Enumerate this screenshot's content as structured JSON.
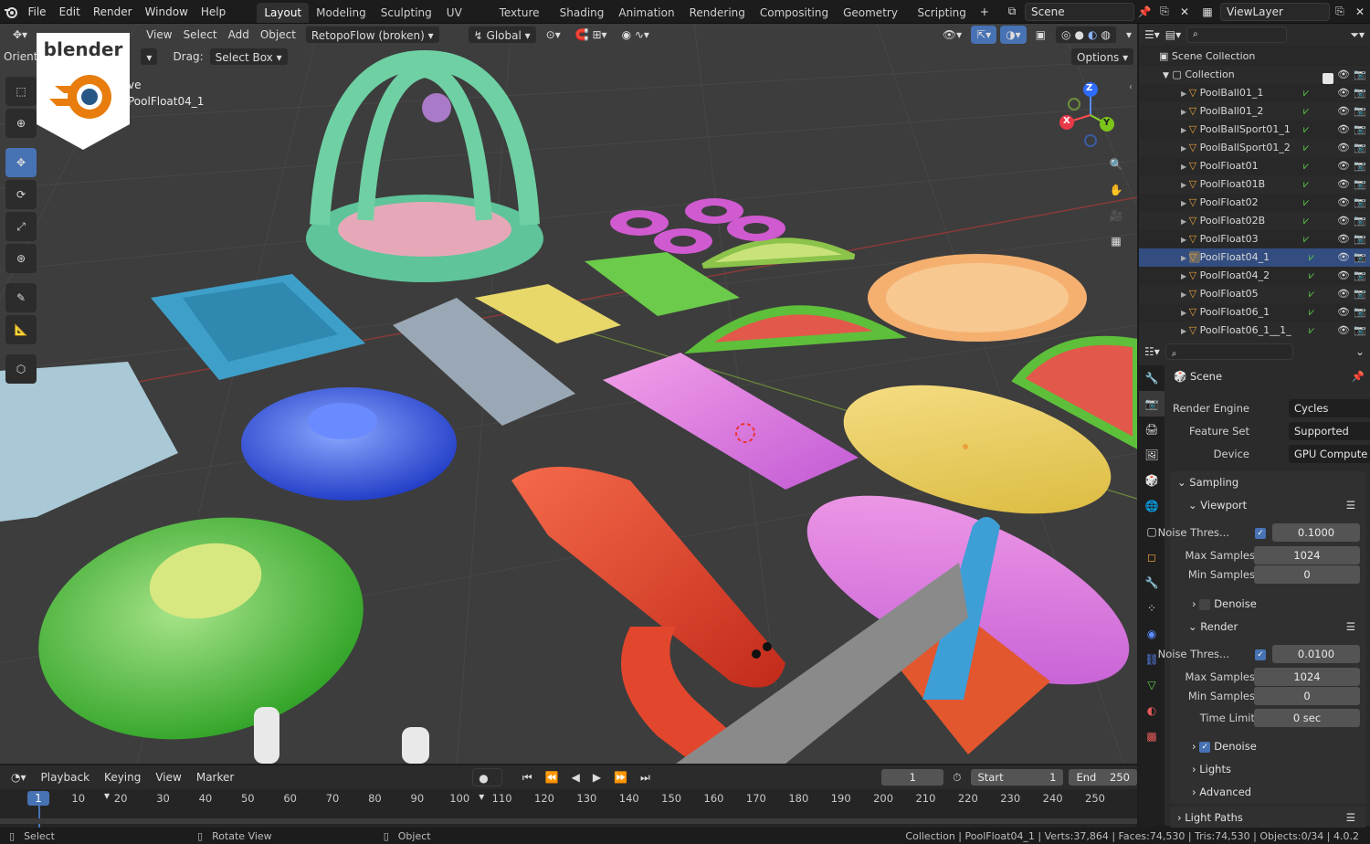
{
  "topbar": {
    "menus": [
      "File",
      "Edit",
      "Render",
      "Window",
      "Help"
    ],
    "workspaces": [
      "Layout",
      "Modeling",
      "Sculpting",
      "UV Editing",
      "Texture Paint",
      "Shading",
      "Animation",
      "Rendering",
      "Compositing",
      "Geometry Nodes",
      "Scripting"
    ],
    "active_workspace": "Layout",
    "add_tab": "+",
    "scene": "Scene",
    "view_layer": "ViewLayer"
  },
  "viewport_header": {
    "menus": [
      "View",
      "Select",
      "Add",
      "Object"
    ],
    "addon": "RetopoFlow (broken)",
    "transform": "Global",
    "orient_label": "Orient",
    "drag_label": "Drag:",
    "drag_value": "Select Box",
    "options": "Options"
  },
  "viewport_overlay": {
    "line1": "ve",
    "line2": "PoolFloat04_1",
    "logo_text": "blender"
  },
  "gizmo": {
    "x": "X",
    "y": "Y",
    "z": "Z"
  },
  "outliner": {
    "scene_collection": "Scene Collection",
    "collection": "Collection",
    "items": [
      "PoolBall01_1",
      "PoolBall01_2",
      "PoolBallSport01_1",
      "PoolBallSport01_2",
      "PoolFloat01",
      "PoolFloat01B",
      "PoolFloat02",
      "PoolFloat02B",
      "PoolFloat03",
      "PoolFloat04_1",
      "PoolFloat04_2",
      "PoolFloat05",
      "PoolFloat06_1",
      "PoolFloat06_1__1_"
    ],
    "selected_item": "PoolFloat04_1"
  },
  "properties": {
    "context": "Scene",
    "render_engine_label": "Render Engine",
    "render_engine": "Cycles",
    "feature_set_label": "Feature Set",
    "feature_set": "Supported",
    "device_label": "Device",
    "device": "GPU Compute",
    "sampling": "Sampling",
    "viewport": "Viewport",
    "noise_label": "Noise Thres...",
    "vp_noise": "0.1000",
    "max_samples_label": "Max Samples",
    "vp_max": "1024",
    "min_samples_label": "Min Samples",
    "vp_min": "0",
    "denoise": "Denoise",
    "render": "Render",
    "r_noise": "0.0100",
    "r_max": "1024",
    "r_min": "0",
    "time_limit_label": "Time Limit",
    "time_limit": "0 sec",
    "lights": "Lights",
    "advanced": "Advanced",
    "light_paths": "Light Paths"
  },
  "timeline": {
    "menus": [
      "Playback",
      "Keying",
      "View",
      "Marker"
    ],
    "current_frame": "1",
    "start_label": "Start",
    "start": "1",
    "end_label": "End",
    "end": "250",
    "ticks": [
      "1",
      "10",
      "20",
      "30",
      "40",
      "50",
      "60",
      "70",
      "80",
      "90",
      "100",
      "110",
      "120",
      "130",
      "140",
      "150",
      "160",
      "170",
      "180",
      "190",
      "200",
      "210",
      "220",
      "230",
      "240",
      "250"
    ]
  },
  "statusbar": {
    "select": "Select",
    "rotate": "Rotate View",
    "object": "Object",
    "info": "Collection | PoolFloat04_1 | Verts:37,864 | Faces:74,530 | Tris:74,530 | Objects:0/34 | 4.0.2"
  },
  "colors": {
    "accent": "#4772b3",
    "header": "#1c1c1c",
    "viewport_bg": "#3d3d3d",
    "selected_orange": "#e8a13a"
  }
}
